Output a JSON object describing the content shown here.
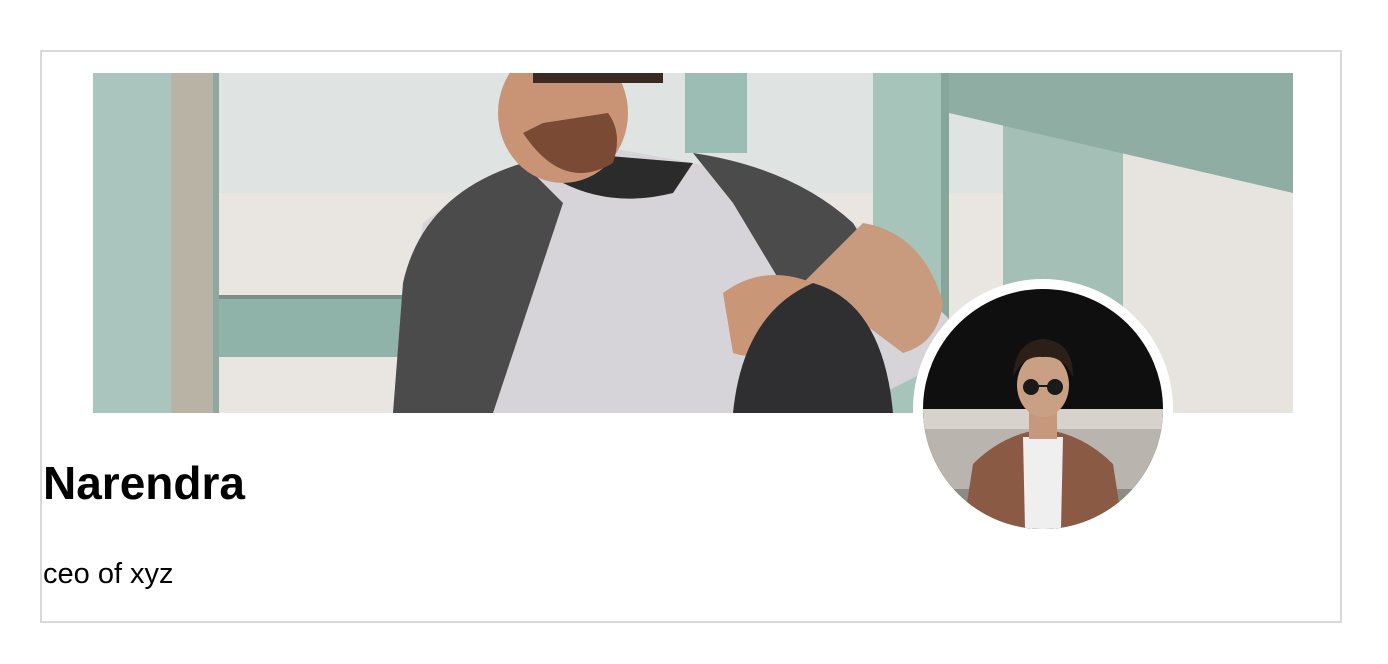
{
  "profile": {
    "name": "Narendra",
    "title": "ceo of xyz"
  }
}
